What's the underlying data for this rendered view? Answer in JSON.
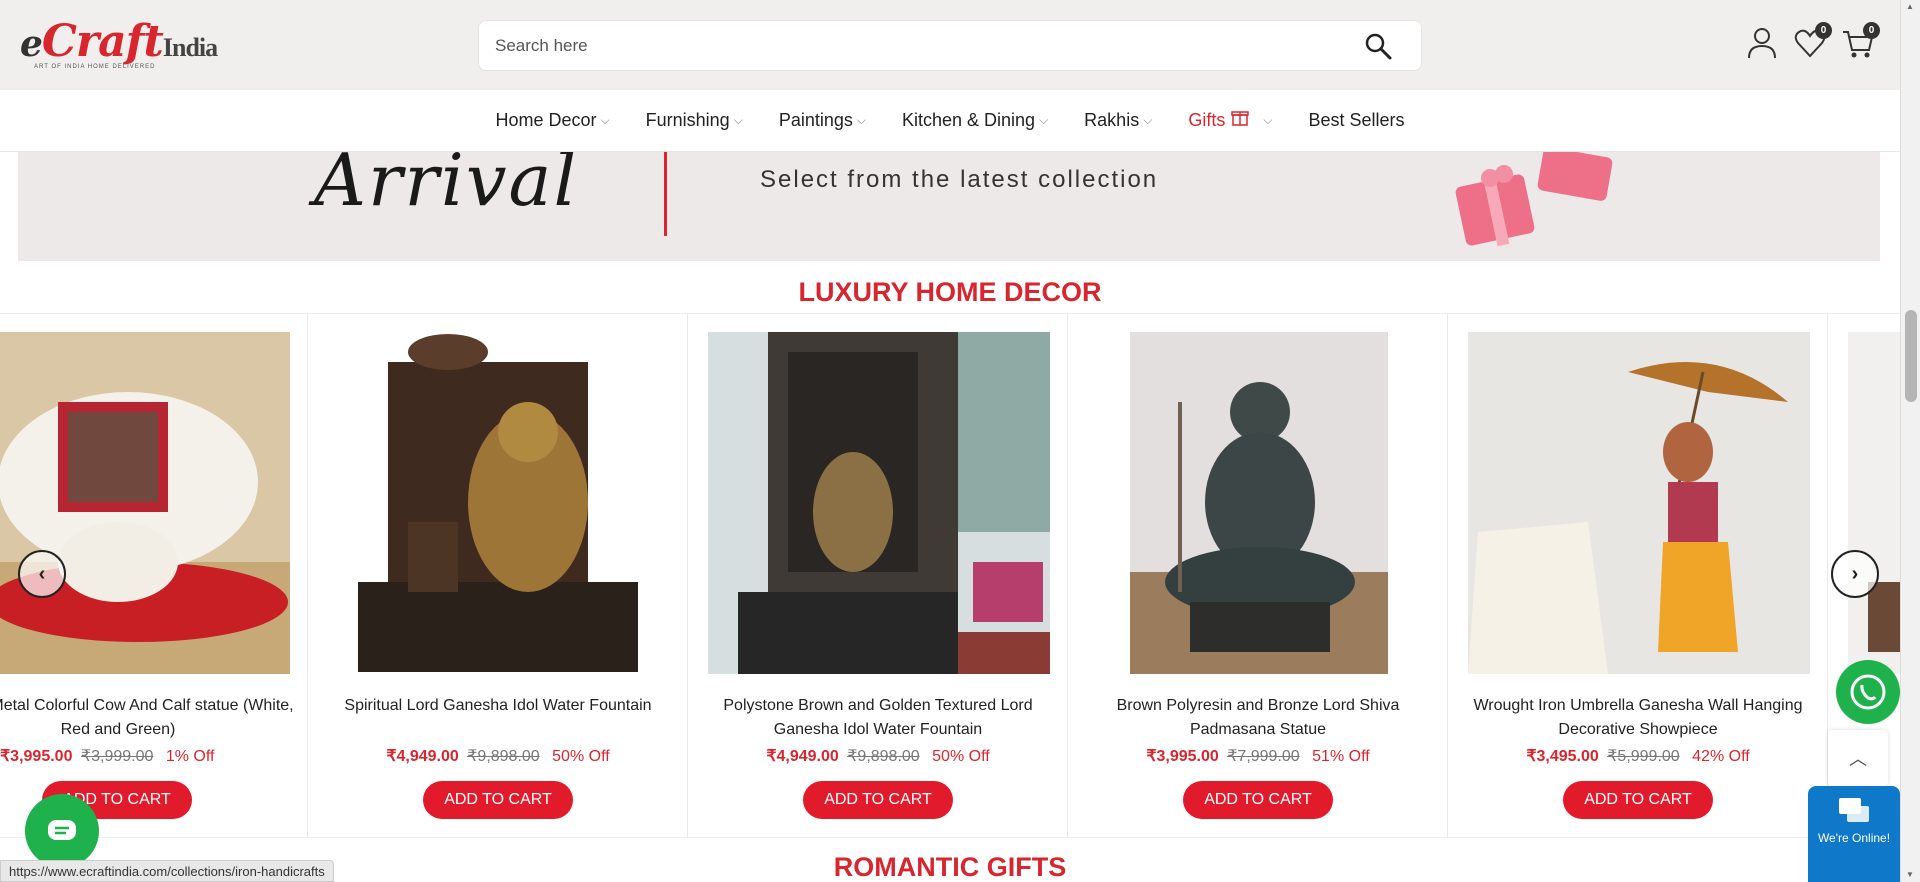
{
  "header": {
    "logo_text": "eCraftIndia",
    "logo_tagline": "ART OF INDIA HOME DELIVERED",
    "search_placeholder": "Search here",
    "wishlist_count": "0",
    "cart_count": "0"
  },
  "nav": {
    "items": [
      {
        "label": "Home Decor",
        "has_dropdown": true
      },
      {
        "label": "Furnishing",
        "has_dropdown": true
      },
      {
        "label": "Paintings",
        "has_dropdown": true
      },
      {
        "label": "Kitchen & Dining",
        "has_dropdown": true
      },
      {
        "label": "Rakhis",
        "has_dropdown": true
      },
      {
        "label": "Gifts",
        "has_dropdown": true
      },
      {
        "label": "Best Sellers",
        "has_dropdown": false
      }
    ]
  },
  "banner": {
    "script_text": "Arrival",
    "subtitle": "Select from the latest collection"
  },
  "sections": {
    "luxury_title": "LUXURY HOME DECOR",
    "romantic_title": "ROMANTIC GIFTS"
  },
  "products": [
    {
      "name": "nakari Metal Colorful Cow And Calf statue (White, Red and Green)",
      "price": "₹3,995.00",
      "mrp": "₹3,999.00",
      "discount": "1% Off",
      "cart_label": "ADD TO CART"
    },
    {
      "name": "Spiritual Lord Ganesha Idol Water Fountain",
      "price": "₹4,949.00",
      "mrp": "₹9,898.00",
      "discount": "50% Off",
      "cart_label": "ADD TO CART"
    },
    {
      "name": "Polystone Brown and Golden Textured Lord Ganesha Idol Water Fountain",
      "price": "₹4,949.00",
      "mrp": "₹9,898.00",
      "discount": "50% Off",
      "cart_label": "ADD TO CART"
    },
    {
      "name": "Brown Polyresin and Bronze Lord Shiva Padmasana Statue",
      "price": "₹3,995.00",
      "mrp": "₹7,999.00",
      "discount": "51% Off",
      "cart_label": "ADD TO CART"
    },
    {
      "name": "Wrought Iron Umbrella Ganesha Wall Hanging Decorative Showpiece",
      "price": "₹3,495.00",
      "mrp": "₹5,999.00",
      "discount": "42% Off",
      "cart_label": "ADD TO CART"
    }
  ],
  "widgets": {
    "online_text": "We're Online!"
  },
  "status_bar": {
    "url": "https://www.ecraftindia.com/collections/iron-handicrafts"
  },
  "colors": {
    "brand_red": "#d8262f",
    "cart_button": "#e21b2c",
    "whatsapp": "#1fb14b",
    "chat_blue": "#0f78c9"
  }
}
